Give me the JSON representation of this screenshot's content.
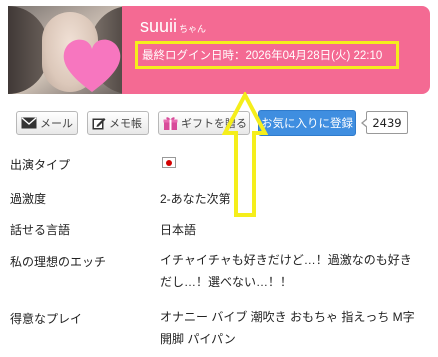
{
  "profile": {
    "name": "suuii",
    "suffix": "ちゃん",
    "last_login": "最終ログイン日時：2026年04月28日(火) 22:10"
  },
  "actions": {
    "mail": "メール",
    "memo": "メモ帳",
    "gift": "ギフトを贈る",
    "favorite": "お気に入りに登録",
    "favorite_count": "2439"
  },
  "details": [
    {
      "label": "出演タイプ",
      "value": ""
    },
    {
      "label": "過激度",
      "value": "2-あなた次第"
    },
    {
      "label": "話せる言語",
      "value": "日本語"
    },
    {
      "label": "私の理想のエッチ",
      "value": "イチャイチャも好きだけど…！過激なのも好きだし…！選べない…！！"
    },
    {
      "label": "得意なプレイ",
      "value": "オナニー バイブ 潮吹き おもちゃ 指えっち M字開脚 パイパン"
    }
  ],
  "colors": {
    "header_pink": "#f46a93",
    "highlight_yellow": "#f5ee1b",
    "favorite_blue": "#3f8ee0"
  },
  "icons": {
    "mail": "envelope-icon",
    "memo": "pencil-note-icon",
    "gift": "gift-box-icon",
    "photo_overlay": "heart-icon",
    "flag": "japan-flag-icon",
    "annotation": "up-arrow-icon"
  }
}
